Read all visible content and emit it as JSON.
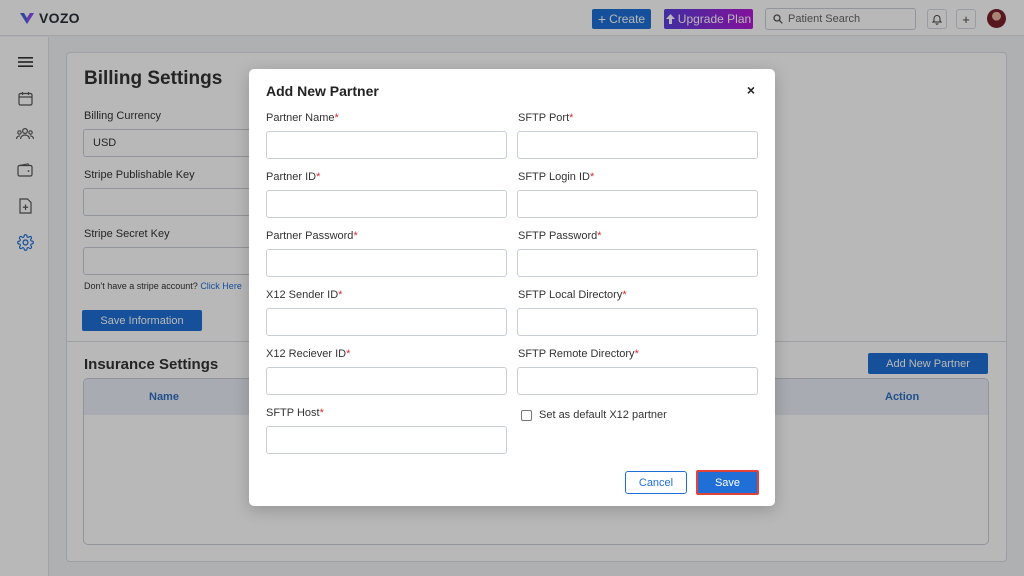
{
  "app": {
    "logo_text": "VOZO"
  },
  "topbar": {
    "create_label": "Create",
    "upgrade_label": "Upgrade Plan",
    "search_placeholder": "Patient Search"
  },
  "billing": {
    "title": "Billing Settings",
    "currency_label": "Billing Currency",
    "currency_value": "USD",
    "publishable_key_label": "Stripe Publishable Key",
    "secret_key_label": "Stripe Secret Key",
    "no_account_text": "Don't have a stripe account?",
    "click_here": "Click Here",
    "save_button": "Save Information"
  },
  "insurance": {
    "title": "Insurance Settings",
    "add_button": "Add New Partner",
    "columns": [
      "Name",
      "Action"
    ]
  },
  "modal": {
    "title": "Add New Partner",
    "close_symbol": "×",
    "left_fields": [
      {
        "label": "Partner Name"
      },
      {
        "label": "Partner ID"
      },
      {
        "label": "Partner Password"
      },
      {
        "label": "X12 Sender ID"
      },
      {
        "label": "X12 Reciever ID"
      },
      {
        "label": "SFTP Host"
      }
    ],
    "right_fields": [
      {
        "label": "SFTP Port"
      },
      {
        "label": "SFTP Login ID"
      },
      {
        "label": "SFTP Password"
      },
      {
        "label": "SFTP Local Directory"
      },
      {
        "label": "SFTP Remote Directory"
      }
    ],
    "required_mark": "*",
    "default_checkbox_label": "Set as default X12 partner",
    "cancel_label": "Cancel",
    "save_label": "Save"
  },
  "colors": {
    "primary": "#1f6fd6",
    "required": "#d32f2f",
    "highlight": "#e0433a"
  }
}
